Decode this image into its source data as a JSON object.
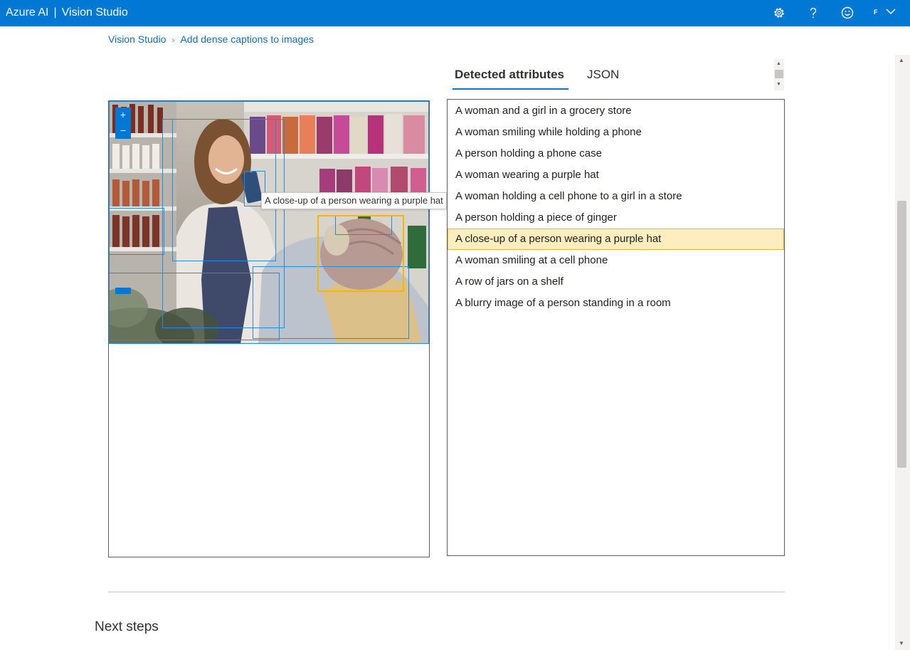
{
  "header": {
    "brand": "Azure AI",
    "product": "Vision Studio",
    "separator": "|",
    "avatar_letter": "F",
    "icons": [
      "settings-gear-icon",
      "help-question-icon",
      "feedback-smiley-icon",
      "chevron-down-icon"
    ]
  },
  "breadcrumb": {
    "items": [
      "Vision Studio",
      "Add dense captions to images"
    ],
    "separator": "›"
  },
  "image_view": {
    "zoom_in": "+",
    "zoom_out": "−",
    "tooltip": "A close-up of a person wearing a purple hat"
  },
  "tabs": [
    {
      "label": "Detected attributes",
      "active": true
    },
    {
      "label": "JSON",
      "active": false
    }
  ],
  "captions": [
    "A woman and a girl in a grocery store",
    "A woman smiling while holding a phone",
    "A person holding a phone case",
    "A woman wearing a purple hat",
    "A woman holding a cell phone to a girl in a store",
    "A person holding a piece of ginger",
    "A close-up of a person wearing a purple hat",
    "A woman smiling at a cell phone",
    "A row of jars on a shelf",
    "A blurry image of a person standing in a room"
  ],
  "selected_caption_index": 6,
  "sections": {
    "next_steps": "Next steps"
  },
  "colors": {
    "brand_blue": "#0078d4",
    "selected_box": "#f2b900",
    "selected_row": "#fdedbf"
  }
}
